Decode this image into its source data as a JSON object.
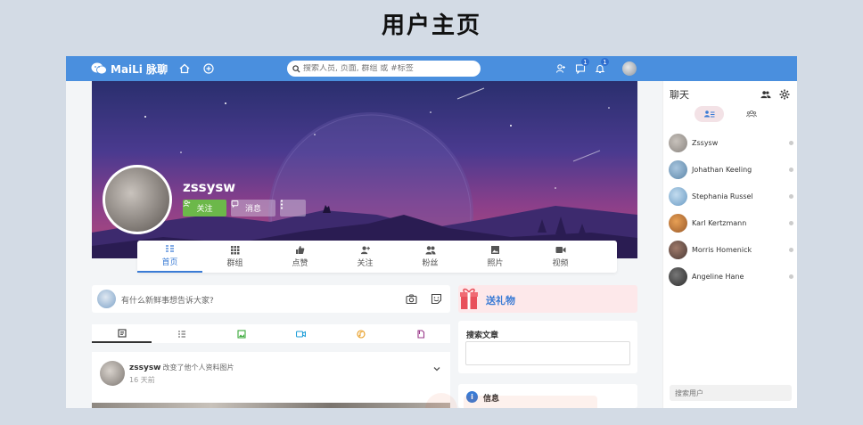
{
  "page": {
    "heading": "用户主页"
  },
  "colors": {
    "topbar": "#4a8fde",
    "accent": "#3a7bd5",
    "follow": "#6cb84a",
    "gift_bg": "#fde8ea"
  },
  "topbar": {
    "logo_text": "MaiLi 脉聊",
    "search_placeholder": "搜索人员, 页面, 群组 或 #标签",
    "notifications": [
      {
        "icon": "add-user-icon",
        "badge": ""
      },
      {
        "icon": "chat-icon",
        "badge": "1"
      },
      {
        "icon": "bell-icon",
        "badge": "1"
      }
    ]
  },
  "profile": {
    "username": "zssysw",
    "follow_label": "关注",
    "message_label": "消息",
    "tabs": [
      {
        "label": "首页",
        "icon": "home-icon",
        "active": true
      },
      {
        "label": "群组",
        "icon": "grid-icon",
        "active": false
      },
      {
        "label": "点赞",
        "icon": "thumbs-up-icon",
        "active": false
      },
      {
        "label": "关注",
        "icon": "add-user-icon",
        "active": false
      },
      {
        "label": "粉丝",
        "icon": "users-icon",
        "active": false
      },
      {
        "label": "照片",
        "icon": "image-icon",
        "active": false
      },
      {
        "label": "视频",
        "icon": "video-icon",
        "active": false
      }
    ]
  },
  "composer": {
    "placeholder": "有什么新鲜事想告诉大家?"
  },
  "post_types": [
    "text-icon",
    "list-icon",
    "image-icon",
    "video-icon",
    "audio-icon",
    "file-icon"
  ],
  "post": {
    "author": "zssysw",
    "action": "改变了他个人资料图片",
    "time": "16 天前"
  },
  "sidebar": {
    "gift_label": "送礼物",
    "search_articles_label": "搜索文章",
    "info_label": "信息"
  },
  "chat": {
    "title": "聊天",
    "contacts": [
      {
        "name": "Zssysw",
        "color": "#8a8580"
      },
      {
        "name": "Johathan Keeling",
        "color": "#5c86a8"
      },
      {
        "name": "Stephania Russel",
        "color": "#6a9bc4"
      },
      {
        "name": "Karl Kertzmann",
        "color": "#9a5a2a"
      },
      {
        "name": "Morris Homenick",
        "color": "#4a3a36"
      },
      {
        "name": "Angeline Hane",
        "color": "#2d2d2d"
      }
    ],
    "search_placeholder": "搜索用户"
  }
}
